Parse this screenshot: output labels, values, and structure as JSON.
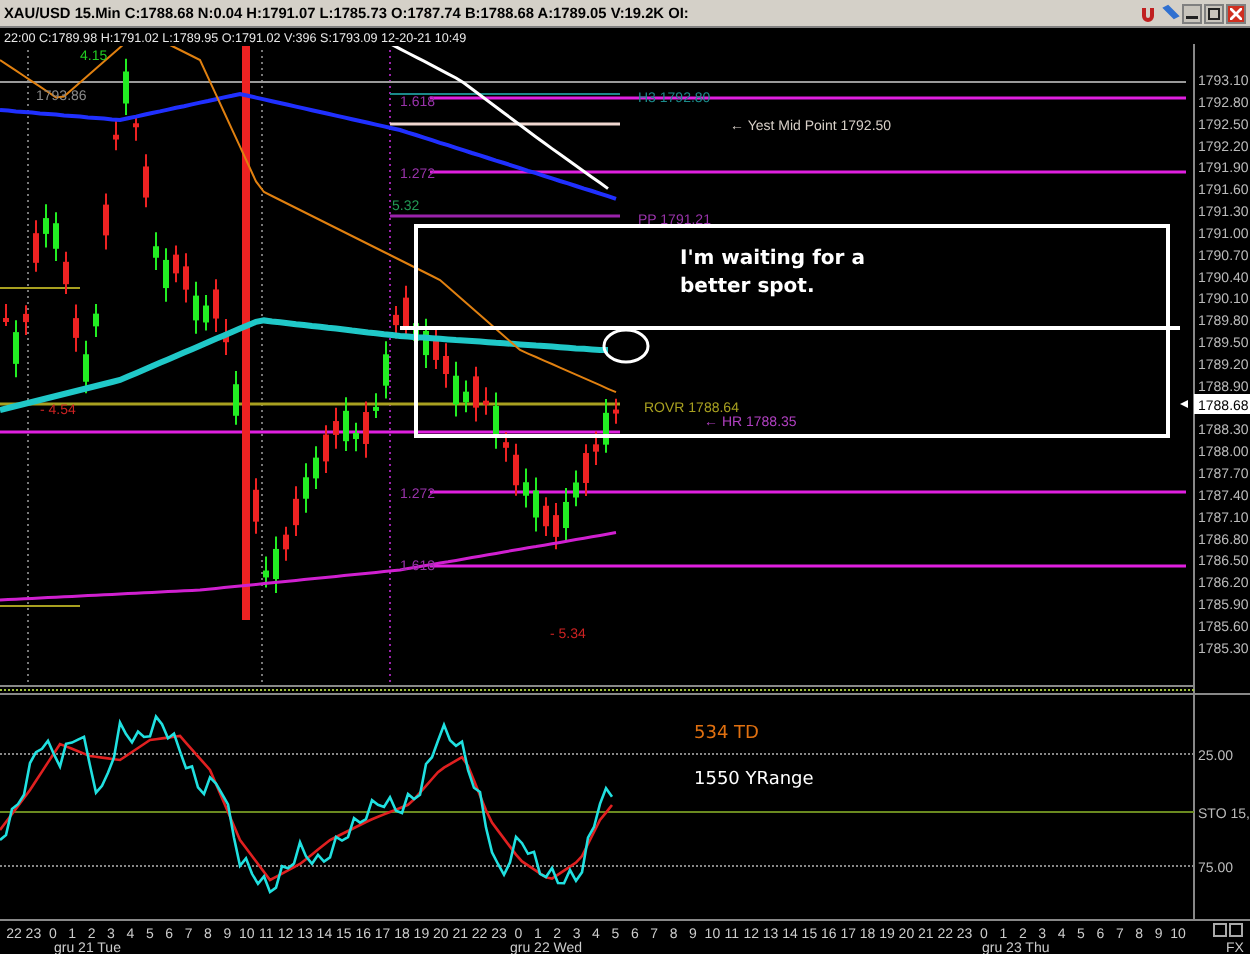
{
  "title_bar": {
    "text": "XAU/USD  15.Min  C:1788.68  N:0.04  H:1791.07  L:1785.73  O:1787.74  B:1788.68  A:1789.05  V:19.2K  OI:"
  },
  "info_line": "22:00  C:1789.98  H:1791.02  L:1789.95  O:1791.02  V:396  S:1793.09  12-20-21  10:49",
  "price_axis": {
    "labels": [
      "1793.10",
      "1792.80",
      "1792.50",
      "1792.20",
      "1791.90",
      "1791.60",
      "1791.30",
      "1791.00",
      "1790.70",
      "1790.40",
      "1790.10",
      "1789.80",
      "1789.50",
      "1789.20",
      "1788.90",
      "1788.30",
      "1788.00",
      "1787.70",
      "1787.40",
      "1787.10",
      "1786.80",
      "1786.50",
      "1786.20",
      "1785.90",
      "1785.60",
      "1785.30"
    ],
    "current": "1788.68"
  },
  "chart_labels": [
    {
      "text": "4.15",
      "color": "#22cc22"
    },
    {
      "text": "1793.86",
      "color": "#8a8a8a"
    },
    {
      "text": "1.618",
      "color": "#9933aa"
    },
    {
      "text": "H3 1792.80",
      "color": "#1a8a8a"
    },
    {
      "text": "← Yest Mid Point 1792.50",
      "color": "#d8d0c8"
    },
    {
      "text": "1.272",
      "color": "#9933aa"
    },
    {
      "text": "PP 1791.21",
      "color": "#9933aa"
    },
    {
      "text": "5.32",
      "color": "#229955"
    },
    {
      "text": "ROVR 1788.64",
      "color": "#a8a020"
    },
    {
      "text": "← HR 1788.35",
      "color": "#b040c0"
    },
    {
      "text": "1.272",
      "color": "#9933aa"
    },
    {
      "text": "1.618",
      "color": "#9933aa"
    },
    {
      "text": "- 5.34",
      "color": "#cc2222"
    },
    {
      "text": "- 4.54",
      "color": "#cc2222"
    }
  ],
  "note": "I'm waiting for a better spot.",
  "oscillator": {
    "levels": [
      "25.00",
      "75.00"
    ],
    "indicator": "STO  15,",
    "notes": [
      {
        "text": "534 TD",
        "color": "#e07010"
      },
      {
        "text": "1550 YRange",
        "color": "#ffffff"
      }
    ]
  },
  "time_axis": {
    "hours": [
      "22",
      "23",
      "0",
      "1",
      "2",
      "3",
      "4",
      "5",
      "6",
      "7",
      "8",
      "9",
      "10",
      "11",
      "12",
      "13",
      "14",
      "15",
      "16",
      "17",
      "18",
      "19",
      "20",
      "21",
      "22",
      "23",
      "0",
      "1",
      "2",
      "3",
      "4",
      "5",
      "6",
      "7",
      "8",
      "9",
      "10",
      "11",
      "12",
      "13",
      "14",
      "15",
      "16",
      "17",
      "18",
      "19",
      "20",
      "21",
      "22",
      "23",
      "0",
      "1",
      "2",
      "3",
      "4",
      "5",
      "6",
      "7",
      "8",
      "9",
      "10"
    ],
    "dates": [
      "gru 21 Tue",
      "gru 22 Wed",
      "gru 23 Thu"
    ],
    "corner_label": "FX"
  }
}
